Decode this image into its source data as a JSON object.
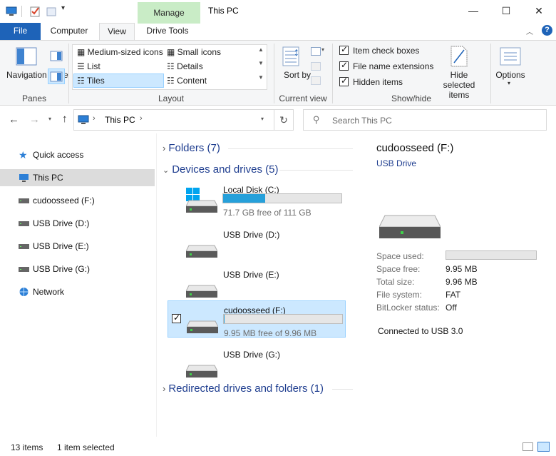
{
  "titlebar": {
    "context_tab": "Manage",
    "title": "This PC"
  },
  "tabs": [
    {
      "label": "File"
    },
    {
      "label": "Computer"
    },
    {
      "label": "View"
    },
    {
      "label": "Drive Tools"
    }
  ],
  "ribbon": {
    "panes": {
      "navigation_pane": "Navigation pane",
      "group_label": "Panes"
    },
    "layout": {
      "items": [
        "Medium-sized icons",
        "Small icons",
        "List",
        "Details",
        "Tiles",
        "Content"
      ],
      "selected": "Tiles",
      "group_label": "Layout"
    },
    "current_view": {
      "sort_by": "Sort by",
      "group_label": "Current view"
    },
    "show_hide": {
      "item_check_boxes": "Item check boxes",
      "file_name_extensions": "File name extensions",
      "hidden_items": "Hidden items",
      "hide_selected": "Hide selected items",
      "group_label": "Show/hide"
    },
    "options": "Options"
  },
  "address": {
    "path": "This PC",
    "search_placeholder": "Search This PC"
  },
  "nav": [
    {
      "label": "Quick access",
      "icon": "star-icon"
    },
    {
      "label": "This PC",
      "icon": "computer-icon",
      "selected": true
    },
    {
      "label": "cudoosseed (F:)",
      "icon": "usb-drive-icon"
    },
    {
      "label": "USB Drive (D:)",
      "icon": "usb-drive-icon"
    },
    {
      "label": "USB Drive (E:)",
      "icon": "usb-drive-icon"
    },
    {
      "label": "USB Drive (G:)",
      "icon": "usb-drive-icon"
    },
    {
      "label": "Network",
      "icon": "network-icon"
    }
  ],
  "sections": {
    "folders": "Folders (7)",
    "devices": "Devices and drives (5)",
    "redirected": "Redirected drives and folders (1)"
  },
  "drives": [
    {
      "name": "Local Disk (C:)",
      "free": "71.7 GB free of 111 GB",
      "used_fraction": 0.354,
      "bar": true
    },
    {
      "name": "USB Drive (D:)",
      "free": "",
      "bar": false
    },
    {
      "name": "USB Drive (E:)",
      "free": "",
      "bar": false
    },
    {
      "name": "cudoosseed (F:)",
      "free": "9.95 MB free of 9.96 MB",
      "used_fraction": 0.001,
      "bar": true,
      "selected": true
    },
    {
      "name": "USB Drive (G:)",
      "free": "",
      "bar": false
    }
  ],
  "details": {
    "title": "cudoosseed (F:)",
    "subtitle": "USB Drive",
    "space_used_label": "Space used:",
    "space_free_label": "Space free:",
    "space_free": "9.95 MB",
    "total_size_label": "Total size:",
    "total_size": "9.96 MB",
    "file_system_label": "File system:",
    "file_system": "FAT",
    "bitlocker_label": "BitLocker status:",
    "bitlocker": "Off",
    "connection": "Connected to USB 3.0"
  },
  "status": {
    "items": "13 items",
    "selected": "1 item selected"
  },
  "colors": {
    "accent": "#1e63b8",
    "manage_tab": "#c9ecc6",
    "bar_fill": "#26a0da",
    "selection": "#cce8ff"
  }
}
